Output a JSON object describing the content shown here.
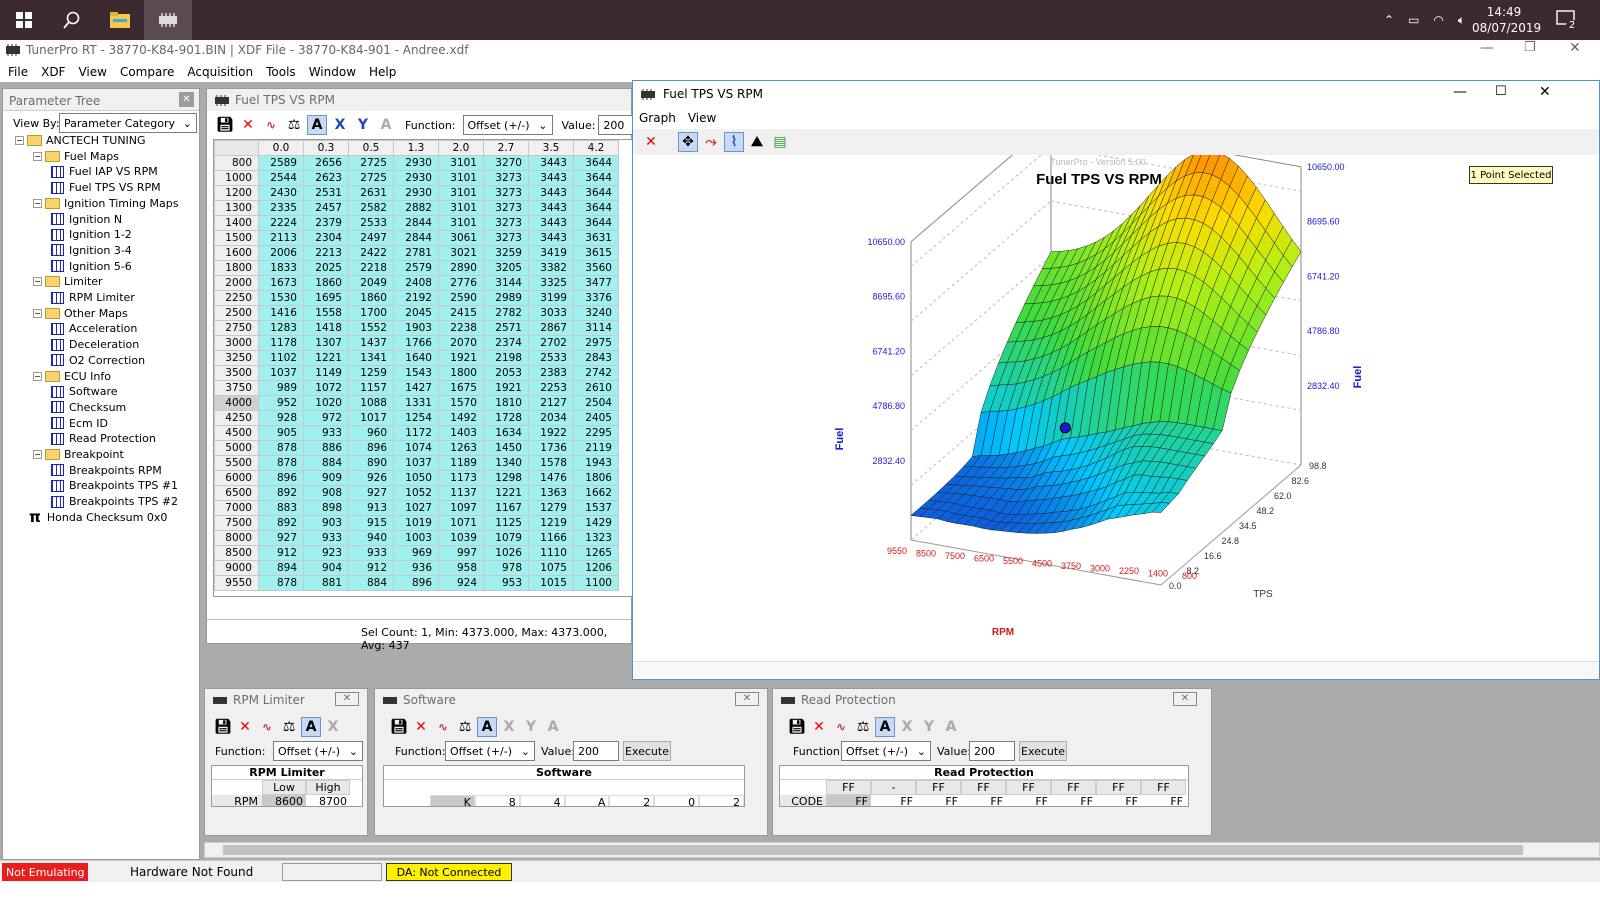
{
  "taskbar": {
    "time": "14:49",
    "date": "08/07/2019",
    "notif_count": "2"
  },
  "app": {
    "title": "TunerPro RT - 38770-K84-901.BIN | XDF File - 38770-K84-901 - Andree.xdf"
  },
  "menu": [
    "File",
    "XDF",
    "View",
    "Compare",
    "Acquisition",
    "Tools",
    "Window",
    "Help"
  ],
  "param_tree": {
    "title": "Parameter Tree",
    "view_by_label": "View By:",
    "view_by_value": "Parameter Category",
    "items": [
      {
        "label": "ANCTECH TUNING",
        "level": 0,
        "type": "folder"
      },
      {
        "label": "Fuel Maps",
        "level": 1,
        "type": "folder"
      },
      {
        "label": "Fuel IAP VS RPM",
        "level": 2,
        "type": "table"
      },
      {
        "label": "Fuel TPS VS RPM",
        "level": 2,
        "type": "table"
      },
      {
        "label": "Ignition Timing Maps",
        "level": 1,
        "type": "folder"
      },
      {
        "label": "Ignition N",
        "level": 2,
        "type": "table"
      },
      {
        "label": "Ignition 1-2",
        "level": 2,
        "type": "table"
      },
      {
        "label": "Ignition 3-4",
        "level": 2,
        "type": "table"
      },
      {
        "label": "Ignition 5-6",
        "level": 2,
        "type": "table"
      },
      {
        "label": "Limiter",
        "level": 1,
        "type": "folder"
      },
      {
        "label": "RPM Limiter",
        "level": 2,
        "type": "table"
      },
      {
        "label": "Other Maps",
        "level": 1,
        "type": "folder"
      },
      {
        "label": "Acceleration",
        "level": 2,
        "type": "table"
      },
      {
        "label": "Deceleration",
        "level": 2,
        "type": "table"
      },
      {
        "label": "O2 Correction",
        "level": 2,
        "type": "table"
      },
      {
        "label": "ECU Info",
        "level": 1,
        "type": "folder"
      },
      {
        "label": "Software",
        "level": 2,
        "type": "table"
      },
      {
        "label": "Checksum",
        "level": 2,
        "type": "table"
      },
      {
        "label": "Ecm ID",
        "level": 2,
        "type": "table"
      },
      {
        "label": "Read Protection",
        "level": 2,
        "type": "table"
      },
      {
        "label": "Breakpoint",
        "level": 1,
        "type": "folder"
      },
      {
        "label": "Breakpoints RPM",
        "level": 2,
        "type": "table"
      },
      {
        "label": "Breakpoints TPS #1",
        "level": 2,
        "type": "table"
      },
      {
        "label": "Breakpoints TPS #2",
        "level": 2,
        "type": "table"
      },
      {
        "label": "Honda Checksum 0x0",
        "level": 0,
        "type": "pi"
      }
    ]
  },
  "table_window": {
    "title": "Fuel TPS VS RPM",
    "function_label": "Function:",
    "function_value": "Offset (+/-)",
    "value_label": "Value:",
    "value": "200",
    "cols": [
      "0.0",
      "0.3",
      "0.5",
      "1.3",
      "2.0",
      "2.7",
      "3.5",
      "4.2"
    ],
    "rows": [
      [
        "800",
        "2589",
        "2656",
        "2725",
        "2930",
        "3101",
        "3270",
        "3443",
        "3644"
      ],
      [
        "1000",
        "2544",
        "2623",
        "2725",
        "2930",
        "3101",
        "3273",
        "3443",
        "3644"
      ],
      [
        "1200",
        "2430",
        "2531",
        "2631",
        "2930",
        "3101",
        "3273",
        "3443",
        "3644"
      ],
      [
        "1300",
        "2335",
        "2457",
        "2582",
        "2882",
        "3101",
        "3273",
        "3443",
        "3644"
      ],
      [
        "1400",
        "2224",
        "2379",
        "2533",
        "2844",
        "3101",
        "3273",
        "3443",
        "3644"
      ],
      [
        "1500",
        "2113",
        "2304",
        "2497",
        "2844",
        "3061",
        "3273",
        "3443",
        "3631"
      ],
      [
        "1600",
        "2006",
        "2213",
        "2422",
        "2781",
        "3021",
        "3259",
        "3419",
        "3615"
      ],
      [
        "1800",
        "1833",
        "2025",
        "2218",
        "2579",
        "2890",
        "3205",
        "3382",
        "3560"
      ],
      [
        "2000",
        "1673",
        "1860",
        "2049",
        "2408",
        "2776",
        "3144",
        "3325",
        "3477"
      ],
      [
        "2250",
        "1530",
        "1695",
        "1860",
        "2192",
        "2590",
        "2989",
        "3199",
        "3376"
      ],
      [
        "2500",
        "1416",
        "1558",
        "1700",
        "2045",
        "2415",
        "2782",
        "3033",
        "3240"
      ],
      [
        "2750",
        "1283",
        "1418",
        "1552",
        "1903",
        "2238",
        "2571",
        "2867",
        "3114"
      ],
      [
        "3000",
        "1178",
        "1307",
        "1437",
        "1766",
        "2070",
        "2374",
        "2702",
        "2975"
      ],
      [
        "3250",
        "1102",
        "1221",
        "1341",
        "1640",
        "1921",
        "2198",
        "2533",
        "2843"
      ],
      [
        "3500",
        "1037",
        "1149",
        "1259",
        "1543",
        "1800",
        "2053",
        "2383",
        "2742"
      ],
      [
        "3750",
        "989",
        "1072",
        "1157",
        "1427",
        "1675",
        "1921",
        "2253",
        "2610"
      ],
      [
        "4000",
        "952",
        "1020",
        "1088",
        "1331",
        "1570",
        "1810",
        "2127",
        "2504"
      ],
      [
        "4250",
        "928",
        "972",
        "1017",
        "1254",
        "1492",
        "1728",
        "2034",
        "2405"
      ],
      [
        "4500",
        "905",
        "933",
        "960",
        "1172",
        "1403",
        "1634",
        "1922",
        "2295"
      ],
      [
        "5000",
        "878",
        "886",
        "896",
        "1074",
        "1263",
        "1450",
        "1736",
        "2119"
      ],
      [
        "5500",
        "878",
        "884",
        "890",
        "1037",
        "1189",
        "1340",
        "1578",
        "1943"
      ],
      [
        "6000",
        "896",
        "909",
        "926",
        "1050",
        "1173",
        "1298",
        "1476",
        "1806"
      ],
      [
        "6500",
        "892",
        "908",
        "927",
        "1052",
        "1137",
        "1221",
        "1363",
        "1662"
      ],
      [
        "7000",
        "883",
        "898",
        "913",
        "1027",
        "1097",
        "1167",
        "1279",
        "1537"
      ],
      [
        "7500",
        "892",
        "903",
        "915",
        "1019",
        "1071",
        "1125",
        "1219",
        "1429"
      ],
      [
        "8000",
        "927",
        "933",
        "940",
        "1003",
        "1039",
        "1079",
        "1166",
        "1323"
      ],
      [
        "8500",
        "912",
        "923",
        "933",
        "969",
        "997",
        "1026",
        "1110",
        "1265"
      ],
      [
        "9000",
        "894",
        "904",
        "912",
        "936",
        "958",
        "978",
        "1075",
        "1206"
      ],
      [
        "9550",
        "878",
        "881",
        "884",
        "896",
        "924",
        "953",
        "1015",
        "1100"
      ]
    ],
    "sel_count": "Sel Count: 1, Min: 4373.000, Max: 4373.000, Avg: 437"
  },
  "graph_window": {
    "title": "Fuel TPS VS RPM",
    "menu": [
      "Graph",
      "View"
    ],
    "chart_title": "Fuel TPS VS RPM",
    "watermark": "TunerPro - Version 5.00",
    "badge": "1 Point Selected",
    "left_axis_label": "Fuel",
    "right_axis_label": "Fuel",
    "rpm_label": "RPM",
    "tps_label": "TPS",
    "left_ticks": [
      "10650.00",
      "8695.60",
      "6741.20",
      "4786.80",
      "2832.40"
    ],
    "right_ticks": [
      "10650.00",
      "8695.60",
      "6741.20",
      "4786.80",
      "2832.40"
    ],
    "rpm_ticks": [
      "9550",
      "8500",
      "7500",
      "6500",
      "5500",
      "4500",
      "3750",
      "3000",
      "2250",
      "1400",
      "800"
    ],
    "tps_ticks": [
      "98.8",
      "82.6",
      "62.0",
      "48.2",
      "34.5",
      "24.8",
      "16.6",
      "8.2",
      "0.0"
    ],
    "colors": {
      "low": "#1d2ecf",
      "mid": "#7fe018",
      "high": "#f29b12"
    }
  },
  "rpm_limiter": {
    "title": "RPM Limiter",
    "function_label": "Function:",
    "function_value": "Offset (+/-)",
    "table_title": "RPM Limiter",
    "col_low": "Low",
    "col_high": "High",
    "row_label": "RPM",
    "low": "8600",
    "high": "8700"
  },
  "software": {
    "title": "Software",
    "function_label": "Function:",
    "function_value": "Offset (+/-)",
    "value_label": "Value:",
    "value": "200",
    "execute": "Execute",
    "table_title": "Software",
    "cells": [
      "K",
      "8",
      "4",
      "A",
      "2",
      "0",
      "2"
    ]
  },
  "read_protection": {
    "title": "Read Protection",
    "function_label": "Function:",
    "function_value": "Offset (+/-)",
    "value_label": "Value:",
    "value": "200",
    "execute": "Execute",
    "table_title": "Read Protection",
    "header": [
      "FF",
      "-",
      "FF",
      "FF",
      "FF",
      "FF",
      "FF",
      "FF"
    ],
    "row_label": "CODE",
    "cells": [
      "FF",
      "FF",
      "FF",
      "FF",
      "FF",
      "FF",
      "FF",
      "FF"
    ]
  },
  "statusbar": {
    "emulating": "Not Emulating",
    "hardware": "Hardware Not Found",
    "da": "DA: Not Connected"
  }
}
